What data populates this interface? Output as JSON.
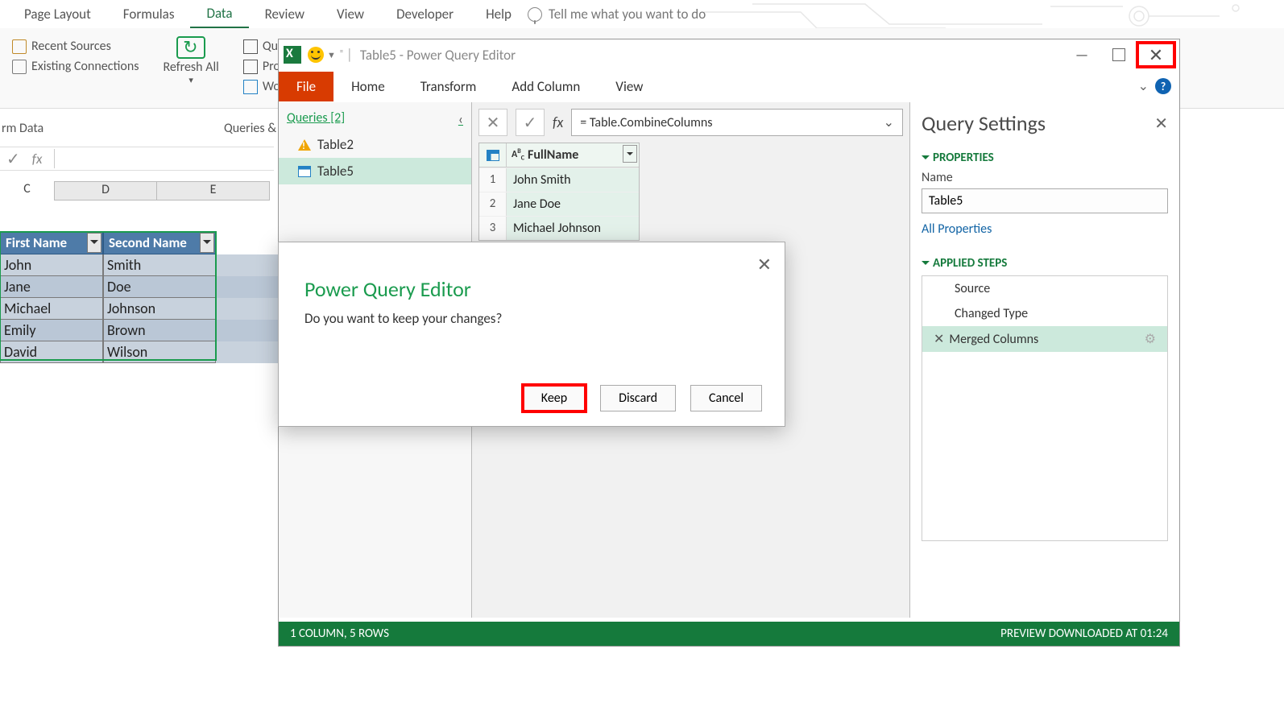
{
  "excel_ribbon": {
    "tabs": [
      "Page Layout",
      "Formulas",
      "Data",
      "Review",
      "View",
      "Developer",
      "Help"
    ],
    "active_tab": "Data",
    "tell_me": "Tell me what you want to do"
  },
  "excel_group": {
    "recent_sources": "Recent Sources",
    "existing_conn": "Existing Connections",
    "refresh": "Refresh All",
    "section1": "rm Data",
    "section2": "Queries &",
    "queries_cut": "Que",
    "props_cut": "Prop",
    "workbook_cut": "Work"
  },
  "sheet": {
    "cols": [
      "C",
      "D",
      "E"
    ],
    "headers": [
      "First Name",
      "Second Name"
    ],
    "rows": [
      [
        "John",
        "Smith"
      ],
      [
        "Jane",
        "Doe"
      ],
      [
        "Michael",
        "Johnson"
      ],
      [
        "Emily",
        "Brown"
      ],
      [
        "David",
        "Wilson"
      ]
    ]
  },
  "pq": {
    "title": "Table5 - Power Query Editor",
    "tabs": [
      "File",
      "Home",
      "Transform",
      "Add Column",
      "View"
    ],
    "queries_title": "Queries [2]",
    "queries": [
      "Table2",
      "Table5"
    ],
    "selected_query": "Table5",
    "formula": "= Table.CombineColumns",
    "preview": {
      "col_header": "FullName",
      "rows": [
        "John Smith",
        "Jane Doe",
        "Michael Johnson"
      ]
    },
    "settings": {
      "title": "Query Settings",
      "properties": "PROPERTIES",
      "name_label": "Name",
      "name_value": "Table5",
      "all_props": "All Properties",
      "applied_steps": "APPLIED STEPS",
      "steps": [
        "Source",
        "Changed Type",
        "Merged Columns"
      ],
      "selected_step": "Merged Columns"
    },
    "status_left": "1 COLUMN, 5 ROWS",
    "status_right": "PREVIEW DOWNLOADED AT 01:24"
  },
  "dialog": {
    "title": "Power Query Editor",
    "message": "Do you want to keep your changes?",
    "keep": "Keep",
    "discard": "Discard",
    "cancel": "Cancel"
  }
}
